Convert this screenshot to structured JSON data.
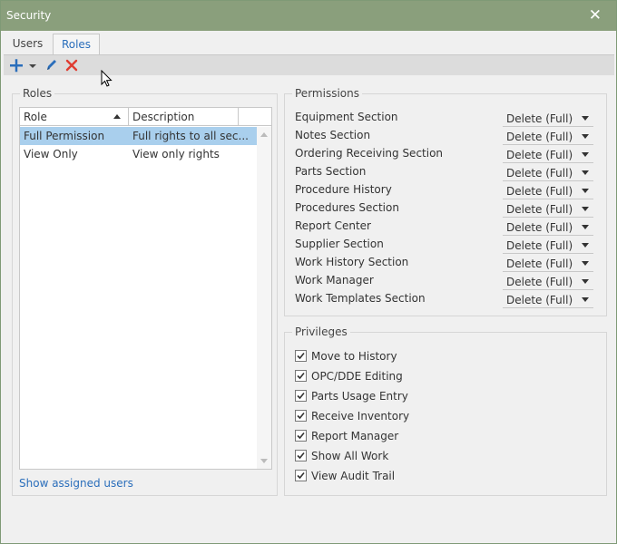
{
  "window": {
    "title": "Security"
  },
  "tabs": [
    {
      "label": "Users"
    },
    {
      "label": "Roles"
    }
  ],
  "roles_group": {
    "title": "Roles",
    "columns": {
      "role": "Role",
      "description": "Description"
    },
    "rows": [
      {
        "role": "Full Permission",
        "description": "Full rights to all sec..."
      },
      {
        "role": "View Only",
        "description": "View only rights"
      }
    ],
    "link": "Show assigned users"
  },
  "permissions_group": {
    "title": "Permissions",
    "items": [
      {
        "label": "Equipment Section",
        "value": "Delete (Full)"
      },
      {
        "label": "Notes Section",
        "value": "Delete (Full)"
      },
      {
        "label": "Ordering Receiving Section",
        "value": "Delete (Full)"
      },
      {
        "label": "Parts Section",
        "value": "Delete (Full)"
      },
      {
        "label": "Procedure History",
        "value": "Delete (Full)"
      },
      {
        "label": "Procedures Section",
        "value": "Delete (Full)"
      },
      {
        "label": "Report Center",
        "value": "Delete (Full)"
      },
      {
        "label": "Supplier Section",
        "value": "Delete (Full)"
      },
      {
        "label": "Work History Section",
        "value": "Delete (Full)"
      },
      {
        "label": "Work Manager",
        "value": "Delete (Full)"
      },
      {
        "label": "Work Templates Section",
        "value": "Delete (Full)"
      }
    ]
  },
  "privileges_group": {
    "title": "Privileges",
    "items": [
      {
        "label": "Move to History",
        "checked": true
      },
      {
        "label": "OPC/DDE Editing",
        "checked": true
      },
      {
        "label": "Parts Usage Entry",
        "checked": true
      },
      {
        "label": "Receive Inventory",
        "checked": true
      },
      {
        "label": "Report Manager",
        "checked": true
      },
      {
        "label": "Show All Work",
        "checked": true
      },
      {
        "label": "View Audit Trail",
        "checked": true
      }
    ]
  },
  "colors": {
    "titlebar": "#8a9f7c",
    "accent": "#2a6ebb",
    "selection": "#a9cfed",
    "delete_icon": "#e03c31"
  },
  "icons": {
    "add": "plus-icon",
    "edit": "pencil-icon",
    "delete": "x-icon",
    "close": "close-icon"
  }
}
